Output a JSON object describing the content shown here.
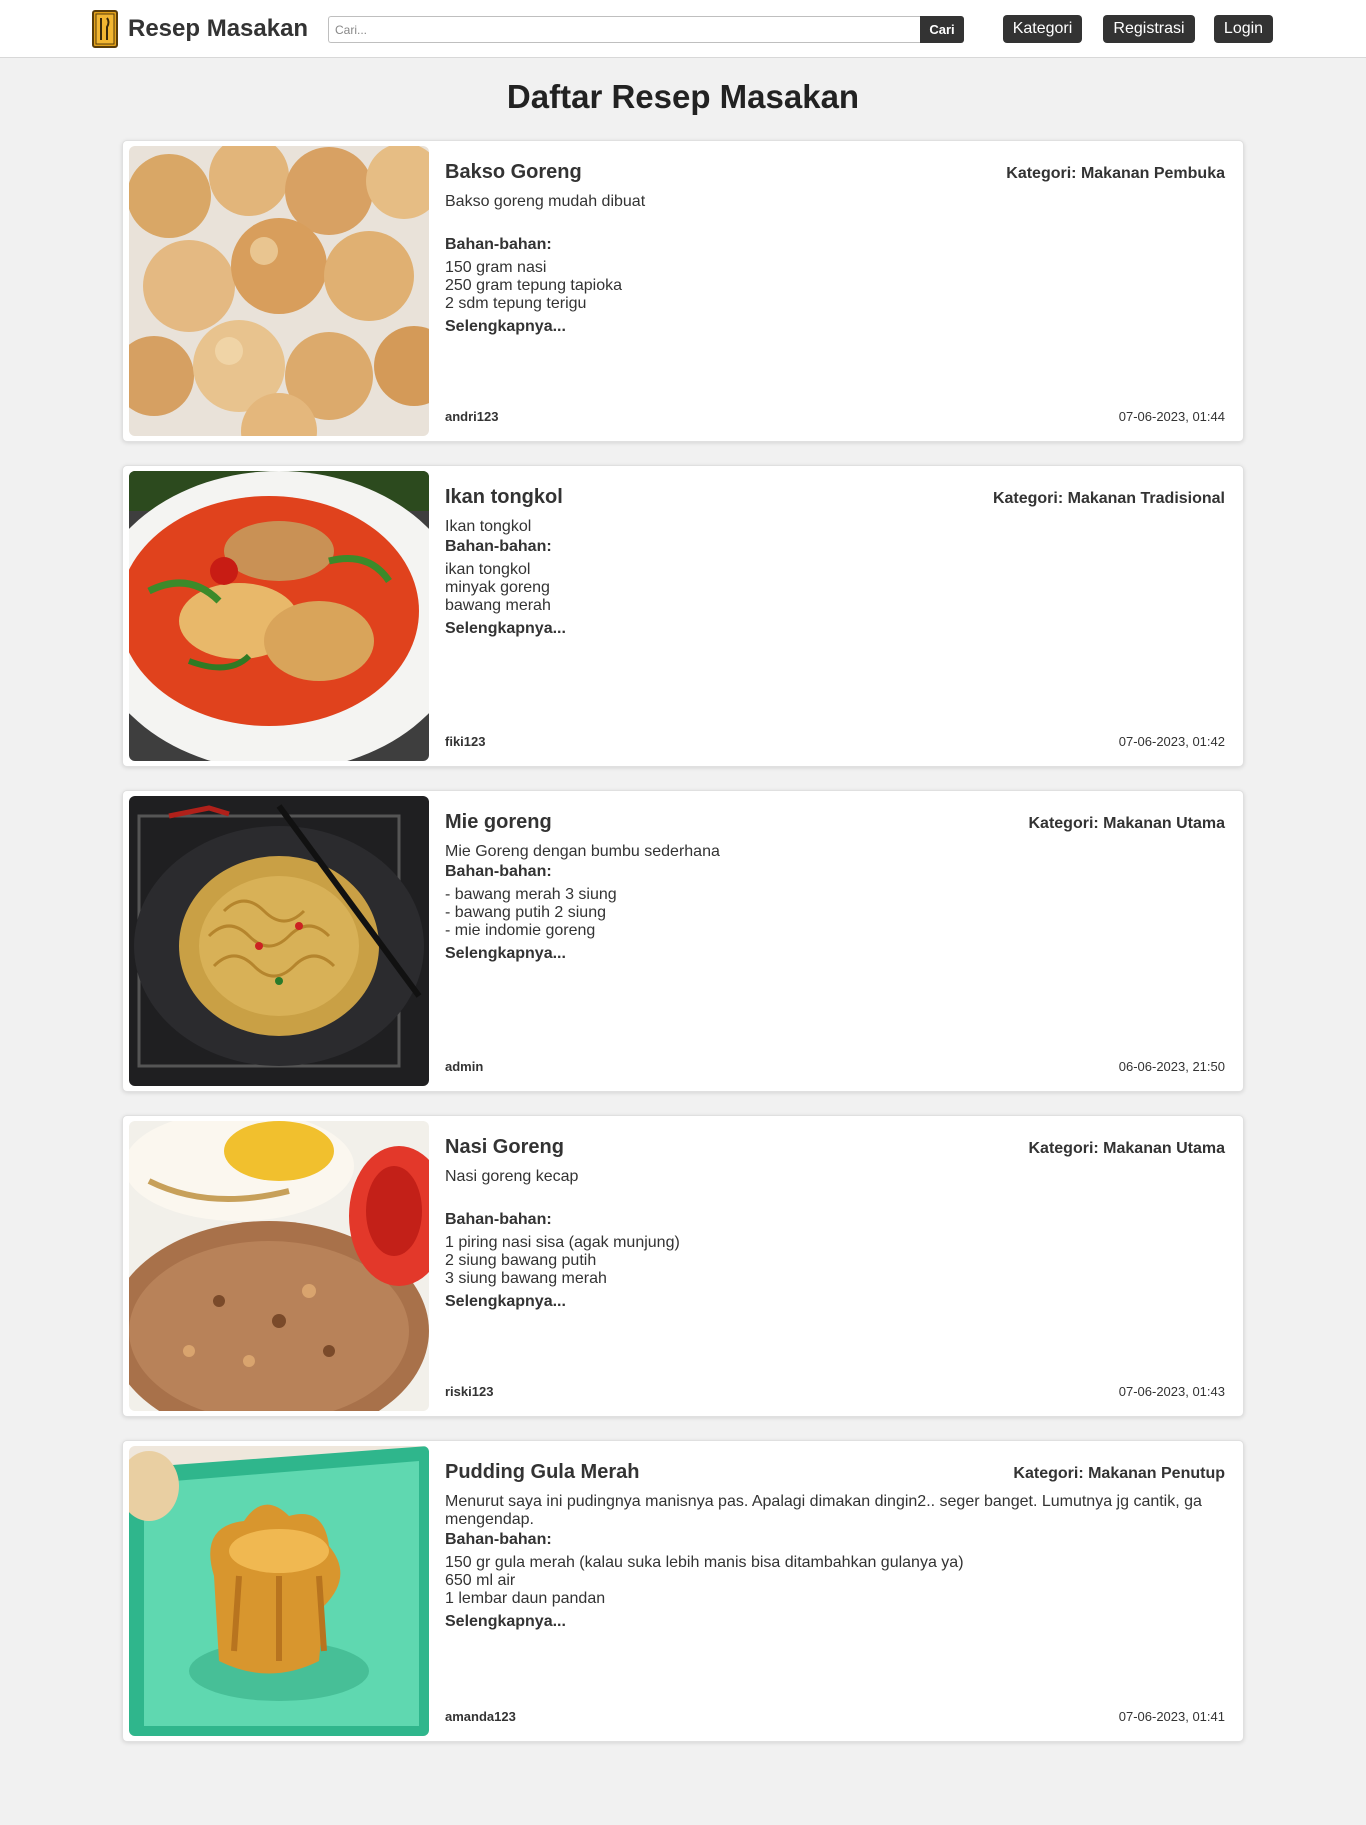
{
  "header": {
    "brand": "Resep Masakan",
    "search_placeholder": "Cari...",
    "search_button": "Cari",
    "nav": {
      "kategori": "Kategori",
      "registrasi": "Registrasi",
      "login": "Login"
    }
  },
  "page_title": "Daftar Resep Masakan",
  "labels": {
    "ingredients": "Bahan-bahan:",
    "read_more": "Selengkapnya..."
  },
  "recipes": [
    {
      "title": "Bakso Goreng",
      "category": "Kategori: Makanan Pembuka",
      "description": "Bakso goreng mudah dibuat",
      "ingredients": [
        "150 gram nasi",
        "250 gram tepung tapioka",
        "2 sdm tepung terigu"
      ],
      "author": "andri123",
      "date": "07-06-2023, 01:44",
      "image": "fried-meatballs-photo"
    },
    {
      "title": "Ikan tongkol",
      "category": "Kategori: Makanan Tradisional",
      "description": "Ikan tongkol",
      "ingredients": [
        "ikan tongkol",
        "minyak goreng",
        "bawang merah"
      ],
      "author": "fiki123",
      "date": "07-06-2023, 01:42",
      "image": "fish-curry-photo"
    },
    {
      "title": "Mie goreng",
      "category": "Kategori: Makanan Utama",
      "description": "Mie Goreng dengan bumbu sederhana",
      "ingredients": [
        "- bawang merah 3 siung",
        "- bawang putih 2 siung",
        "- mie indomie goreng"
      ],
      "author": "admin",
      "date": "06-06-2023, 21:50",
      "image": "fried-noodles-photo"
    },
    {
      "title": "Nasi Goreng",
      "category": "Kategori: Makanan Utama",
      "description": "Nasi goreng kecap",
      "ingredients": [
        "1 piring nasi sisa (agak munjung)",
        "2 siung bawang putih",
        "3 siung bawang merah"
      ],
      "author": "riski123",
      "date": "07-06-2023, 01:43",
      "image": "fried-rice-photo"
    },
    {
      "title": "Pudding Gula Merah",
      "category": "Kategori: Makanan Penutup",
      "description": "Menurut saya ini pudingnya manisnya pas. Apalagi dimakan dingin2.. seger banget. Lumutnya jg cantik, ga mengendap.",
      "ingredients": [
        "150 gr gula merah (kalau suka lebih manis bisa ditambahkan gulanya ya)",
        "650 ml air",
        "1 lembar daun pandan"
      ],
      "author": "amanda123",
      "date": "07-06-2023, 01:41",
      "image": "palm-sugar-pudding-photo"
    }
  ]
}
